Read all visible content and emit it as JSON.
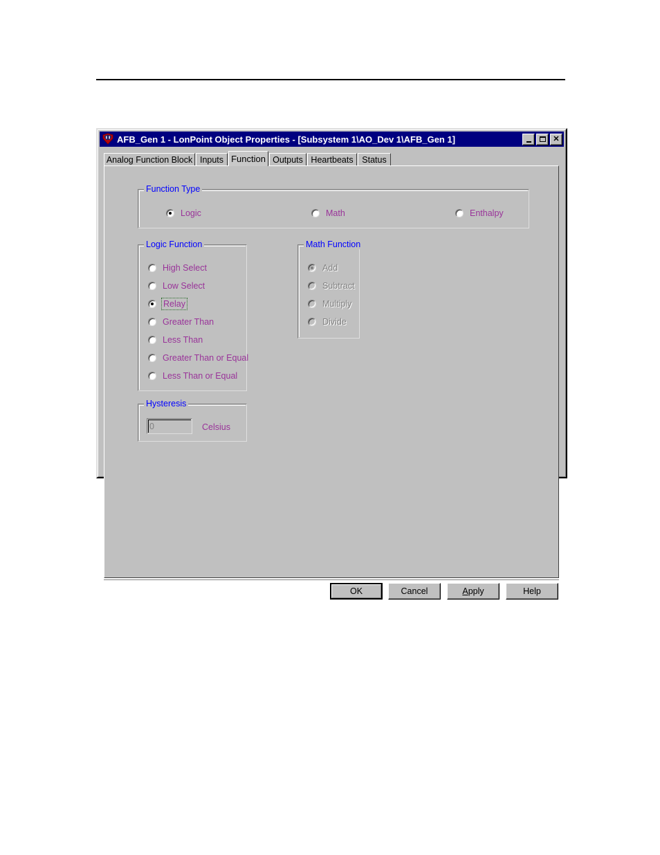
{
  "window": {
    "title": "AFB_Gen 1 - LonPoint Object Properties - [Subsystem 1\\AO_Dev 1\\AFB_Gen 1]",
    "icon": "lonpoint-app-icon",
    "titlebar_color": "#000080",
    "face_color": "#c0c0c0",
    "controls": {
      "minimize": "minimize-icon",
      "maximize": "restore-icon",
      "close": "close-icon"
    }
  },
  "tabs": [
    {
      "label": "Analog Function Block",
      "selected": false
    },
    {
      "label": "Inputs",
      "selected": false
    },
    {
      "label": "Function",
      "selected": true
    },
    {
      "label": "Outputs",
      "selected": false
    },
    {
      "label": "Heartbeats",
      "selected": false
    },
    {
      "label": "Status",
      "selected": false
    }
  ],
  "colors": {
    "group_label": "#0000ff",
    "radio_label": "#993399",
    "disabled_label": "#808080"
  },
  "function_type": {
    "legend": "Function Type",
    "options": [
      {
        "label": "Logic",
        "checked": true,
        "disabled": false
      },
      {
        "label": "Math",
        "checked": false,
        "disabled": false
      },
      {
        "label": "Enthalpy",
        "checked": false,
        "disabled": false
      }
    ]
  },
  "logic_function": {
    "legend": "Logic Function",
    "options": [
      {
        "label": "High Select",
        "checked": false,
        "disabled": false,
        "focused": false
      },
      {
        "label": "Low Select",
        "checked": false,
        "disabled": false,
        "focused": false
      },
      {
        "label": "Relay",
        "checked": true,
        "disabled": false,
        "focused": true
      },
      {
        "label": "Greater Than",
        "checked": false,
        "disabled": false,
        "focused": false
      },
      {
        "label": "Less Than",
        "checked": false,
        "disabled": false,
        "focused": false
      },
      {
        "label": "Greater Than or Equal",
        "checked": false,
        "disabled": false,
        "focused": false
      },
      {
        "label": "Less Than or Equal",
        "checked": false,
        "disabled": false,
        "focused": false
      }
    ]
  },
  "math_function": {
    "legend": "Math Function",
    "disabled": true,
    "options": [
      {
        "label": "Add",
        "checked": true,
        "disabled": true
      },
      {
        "label": "Subtract",
        "checked": false,
        "disabled": true
      },
      {
        "label": "Multiply",
        "checked": false,
        "disabled": true
      },
      {
        "label": "Divide",
        "checked": false,
        "disabled": true
      }
    ]
  },
  "hysteresis": {
    "legend": "Hysteresis",
    "value": "0",
    "unit": "Celsius",
    "disabled": true
  },
  "buttons": {
    "ok": "OK",
    "cancel": "Cancel",
    "apply_prefix": "",
    "apply_accel": "A",
    "apply_rest": "pply",
    "help": "Help"
  }
}
